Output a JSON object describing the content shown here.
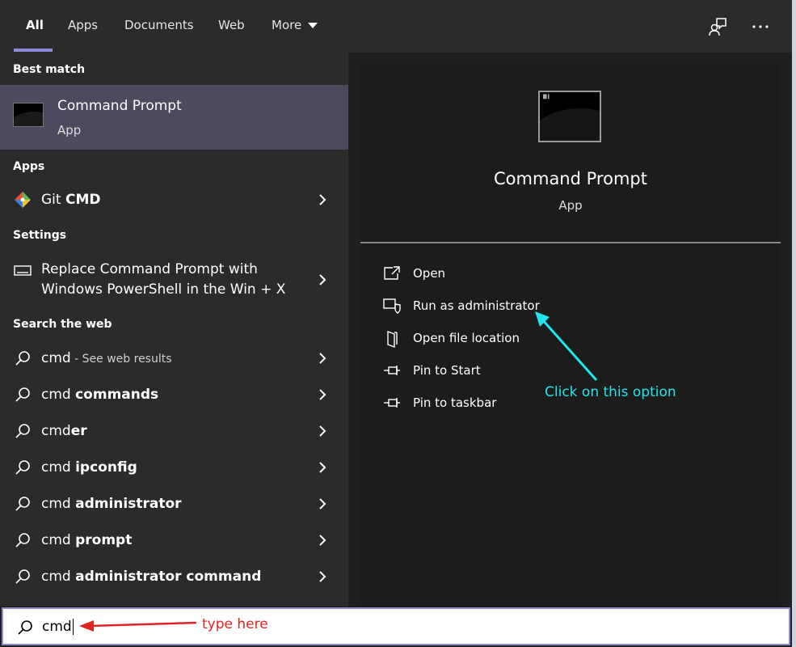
{
  "tabs": [
    {
      "label": "All",
      "active": true
    },
    {
      "label": "Apps"
    },
    {
      "label": "Documents"
    },
    {
      "label": "Web"
    },
    {
      "label": "More"
    }
  ],
  "top_icons": [
    "feedback-icon",
    "more-options-icon"
  ],
  "left": {
    "best_match_label": "Best match",
    "best_match": {
      "title": "Command Prompt",
      "subtitle": "App",
      "icon": "command-prompt-icon"
    },
    "apps_label": "Apps",
    "apps": [
      {
        "prefix": "Git ",
        "bold": "CMD",
        "icon": "git-icon"
      }
    ],
    "settings_label": "Settings",
    "settings": [
      {
        "text": "Replace Command Prompt with Windows PowerShell in the Win + X",
        "icon": "keyboard-icon"
      }
    ],
    "web_label": "Search the web",
    "web_results": [
      {
        "prefix": "cmd",
        "bold": "",
        "suffix": " - See web results"
      },
      {
        "prefix": "cmd ",
        "bold": "commands",
        "suffix": ""
      },
      {
        "prefix": "cmd",
        "bold": "er",
        "suffix": ""
      },
      {
        "prefix": "cmd ",
        "bold": "ipconfig",
        "suffix": ""
      },
      {
        "prefix": "cmd ",
        "bold": "administrator",
        "suffix": ""
      },
      {
        "prefix": "cmd ",
        "bold": "prompt",
        "suffix": ""
      },
      {
        "prefix": "cmd ",
        "bold": "administrator command",
        "suffix": ""
      }
    ]
  },
  "right": {
    "title": "Command Prompt",
    "subtitle": "App",
    "actions": [
      {
        "label": "Open",
        "icon": "open-icon"
      },
      {
        "label": "Run as administrator",
        "icon": "shield-icon"
      },
      {
        "label": "Open file location",
        "icon": "folder-icon"
      },
      {
        "label": "Pin to Start",
        "icon": "pin-icon"
      },
      {
        "label": "Pin to taskbar",
        "icon": "pin-icon"
      }
    ]
  },
  "search": {
    "value": "cmd"
  },
  "annotations": {
    "blue": "Click on this option",
    "red": "type here",
    "blue_color": "#22e6ee",
    "red_color": "#e02424"
  },
  "colors": {
    "accent": "#8c8cd9",
    "selected_row": "#4b4a5e",
    "panel": "#2b2b2b"
  }
}
